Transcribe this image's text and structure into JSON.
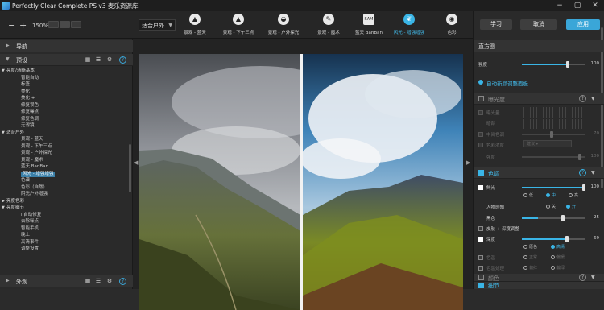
{
  "window": {
    "title": "Perfectly Clear Complete PS v3  麦乐资源库"
  },
  "toolbar": {
    "zoom_out": "−",
    "zoom_in": "+",
    "zoom": "150%",
    "preset_dropdown": "适合户外",
    "presets": [
      {
        "label": "景观 - 蓝天",
        "icon": "mountain-icon",
        "selected": false
      },
      {
        "label": "景观 - 下午三点",
        "icon": "mountain-sun-icon",
        "selected": false
      },
      {
        "label": "景观 - 户外探光",
        "icon": "mountain-circle-icon",
        "selected": false
      },
      {
        "label": "景观 - 魔术",
        "icon": "wand-icon",
        "selected": false
      },
      {
        "label": "蓝天 BanBan",
        "icon": "sam-icon",
        "selected": false
      },
      {
        "label": "风光 - 增强增强",
        "icon": "leaf-icon",
        "selected": true
      },
      {
        "label": "色彩",
        "icon": "palette-icon",
        "selected": false
      }
    ]
  },
  "buttons": {
    "learn": "学习",
    "cancel": "取消",
    "apply": "应用"
  },
  "left_panel": {
    "navigator": "导航",
    "presets_title": "预设",
    "tree": [
      {
        "t": "亮度/清晰基本",
        "lvl": 0,
        "grp": true
      },
      {
        "t": "智能自动",
        "lvl": 1
      },
      {
        "t": "标签",
        "lvl": 1
      },
      {
        "t": "美化",
        "lvl": 1
      },
      {
        "t": "美化 +",
        "lvl": 1
      },
      {
        "t": "修复误色",
        "lvl": 1
      },
      {
        "t": "修复噪点",
        "lvl": 1
      },
      {
        "t": "修复色调",
        "lvl": 1
      },
      {
        "t": "无滤镜",
        "lvl": 1
      },
      {
        "t": "适合户外",
        "lvl": 0,
        "grp": true
      },
      {
        "t": "景观 - 蓝天",
        "lvl": 1
      },
      {
        "t": "景观 - 下午三点",
        "lvl": 1
      },
      {
        "t": "景观 - 户外探光",
        "lvl": 1
      },
      {
        "t": "景观 - 魔术",
        "lvl": 1
      },
      {
        "t": "蓝天 BanBan",
        "lvl": 1
      },
      {
        "t": "风光 - 增强增强",
        "lvl": 1,
        "sel": true
      },
      {
        "t": "色谱",
        "lvl": 1
      },
      {
        "t": "色彩（自然）",
        "lvl": 1
      },
      {
        "t": "阴光户外增强",
        "lvl": 1
      },
      {
        "t": "亮度色彩",
        "lvl": 0,
        "grp": true
      },
      {
        "t": "亮度细节",
        "lvl": 0,
        "grp": true
      },
      {
        "t": "i 自动修复",
        "lvl": 1
      },
      {
        "t": "去除噪点",
        "lvl": 1
      },
      {
        "t": "智能手机",
        "lvl": 1
      },
      {
        "t": "晚上",
        "lvl": 1
      },
      {
        "t": "高清事件",
        "lvl": 1
      },
      {
        "t": "调整设置",
        "lvl": 1
      }
    ],
    "external_title": "外观"
  },
  "right_panel": {
    "histogram": "直方图",
    "strength_label": "强度",
    "strength": 100,
    "auto_panel": "自动新颜调整面板",
    "exposure_section": "曝光度",
    "exposure_rows": [
      {
        "label": "曝光量",
        "value": ""
      },
      {
        "label": "暗部",
        "value": ""
      },
      {
        "label": "中间色调",
        "value": "70"
      },
      {
        "label": "色彩浓度",
        "value": "建议 ▾"
      },
      {
        "label": "强度",
        "value": "100"
      }
    ],
    "color_section": "色调",
    "vibrance_label": "鲜光",
    "vibrance": 100,
    "vibrance_opts": [
      "低",
      "中",
      "高"
    ],
    "skin_label": "人物感知",
    "skin_opts": [
      "关",
      "开"
    ],
    "black_label": "黑色",
    "black": 25,
    "ss_label": "皮肤 + 深度调整",
    "ss_opts": [
      "原色",
      "高清"
    ],
    "depth_label": "深度",
    "depth": 69,
    "temp_label": "色温",
    "temp_opts": [
      "正常",
      "偏暖"
    ],
    "chroma_label": "色温处理",
    "chroma_opts": [
      "偏红",
      "偏绿"
    ],
    "color_extra_section": "颜色",
    "detail_section": "细节"
  }
}
